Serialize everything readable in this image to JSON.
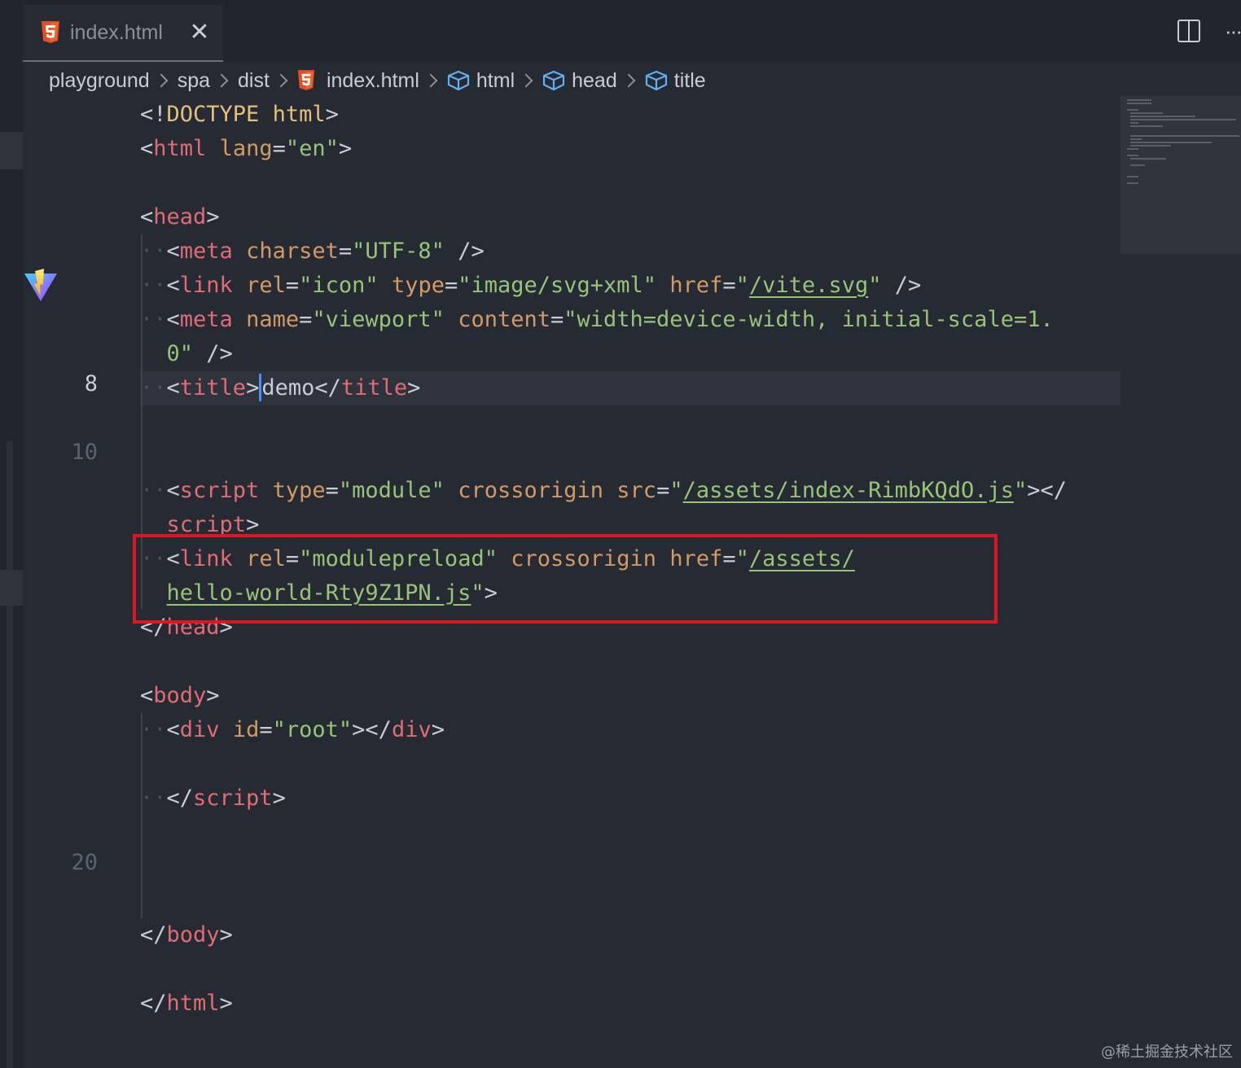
{
  "tab": {
    "label": "index.html",
    "close_glyph": "✕"
  },
  "tab_actions": {
    "more_glyph": "···"
  },
  "breadcrumb": [
    {
      "label": "playground",
      "icon": ""
    },
    {
      "label": "spa",
      "icon": ""
    },
    {
      "label": "dist",
      "icon": ""
    },
    {
      "label": "index.html",
      "icon": "html5-icon"
    },
    {
      "label": "html",
      "icon": "cube-icon"
    },
    {
      "label": "head",
      "icon": "cube-icon"
    },
    {
      "label": "title",
      "icon": "cube-icon"
    }
  ],
  "line_numbers": {
    "current": "8",
    "ln10": "10",
    "ln20": "20"
  },
  "code": {
    "doctype_open": "<!",
    "doctype_kw": "DOCTYPE",
    "doctype_html": "html",
    "html_tag": "html",
    "html_lang_attr": "lang",
    "html_lang_val": "\"en\"",
    "head_tag": "head",
    "meta_tag": "meta",
    "charset_attr": "charset",
    "charset_val": "\"UTF-8\"",
    "link_tag": "link",
    "rel_attr": "rel",
    "icon_val": "\"icon\"",
    "type_attr": "type",
    "svg_val": "\"image/svg+xml\"",
    "href_attr": "href",
    "quote": "\"",
    "vite_path": "/vite.svg",
    "name_attr": "name",
    "viewport_val": "\"viewport\"",
    "content_attr": "content",
    "content_val_1": "\"width=device-width, initial-scale=1.",
    "content_val_2": "0\"",
    "title_tag": "title",
    "title_text": "demo",
    "script_tag": "script",
    "module_val": "\"module\"",
    "crossorigin_attr": "crossorigin",
    "src_attr": "src",
    "script_src_path": "/assets/index-RimbKQdO.js",
    "script_close_tail": "script",
    "modulepreload_val": "\"modulepreload\"",
    "preload_path_1": "/assets/",
    "preload_path_2": "hello-world-Rty9Z1PN.js",
    "body_tag": "body",
    "div_tag": "div",
    "id_attr": "id",
    "root_val": "\"root\""
  },
  "watermark": "@稀土掘金技术社区",
  "colors": {
    "tag": "#e06c75",
    "attribute": "#d19a66",
    "string": "#98c379",
    "punctuation": "#c8ccd4",
    "highlight_box": "#e0151f"
  }
}
